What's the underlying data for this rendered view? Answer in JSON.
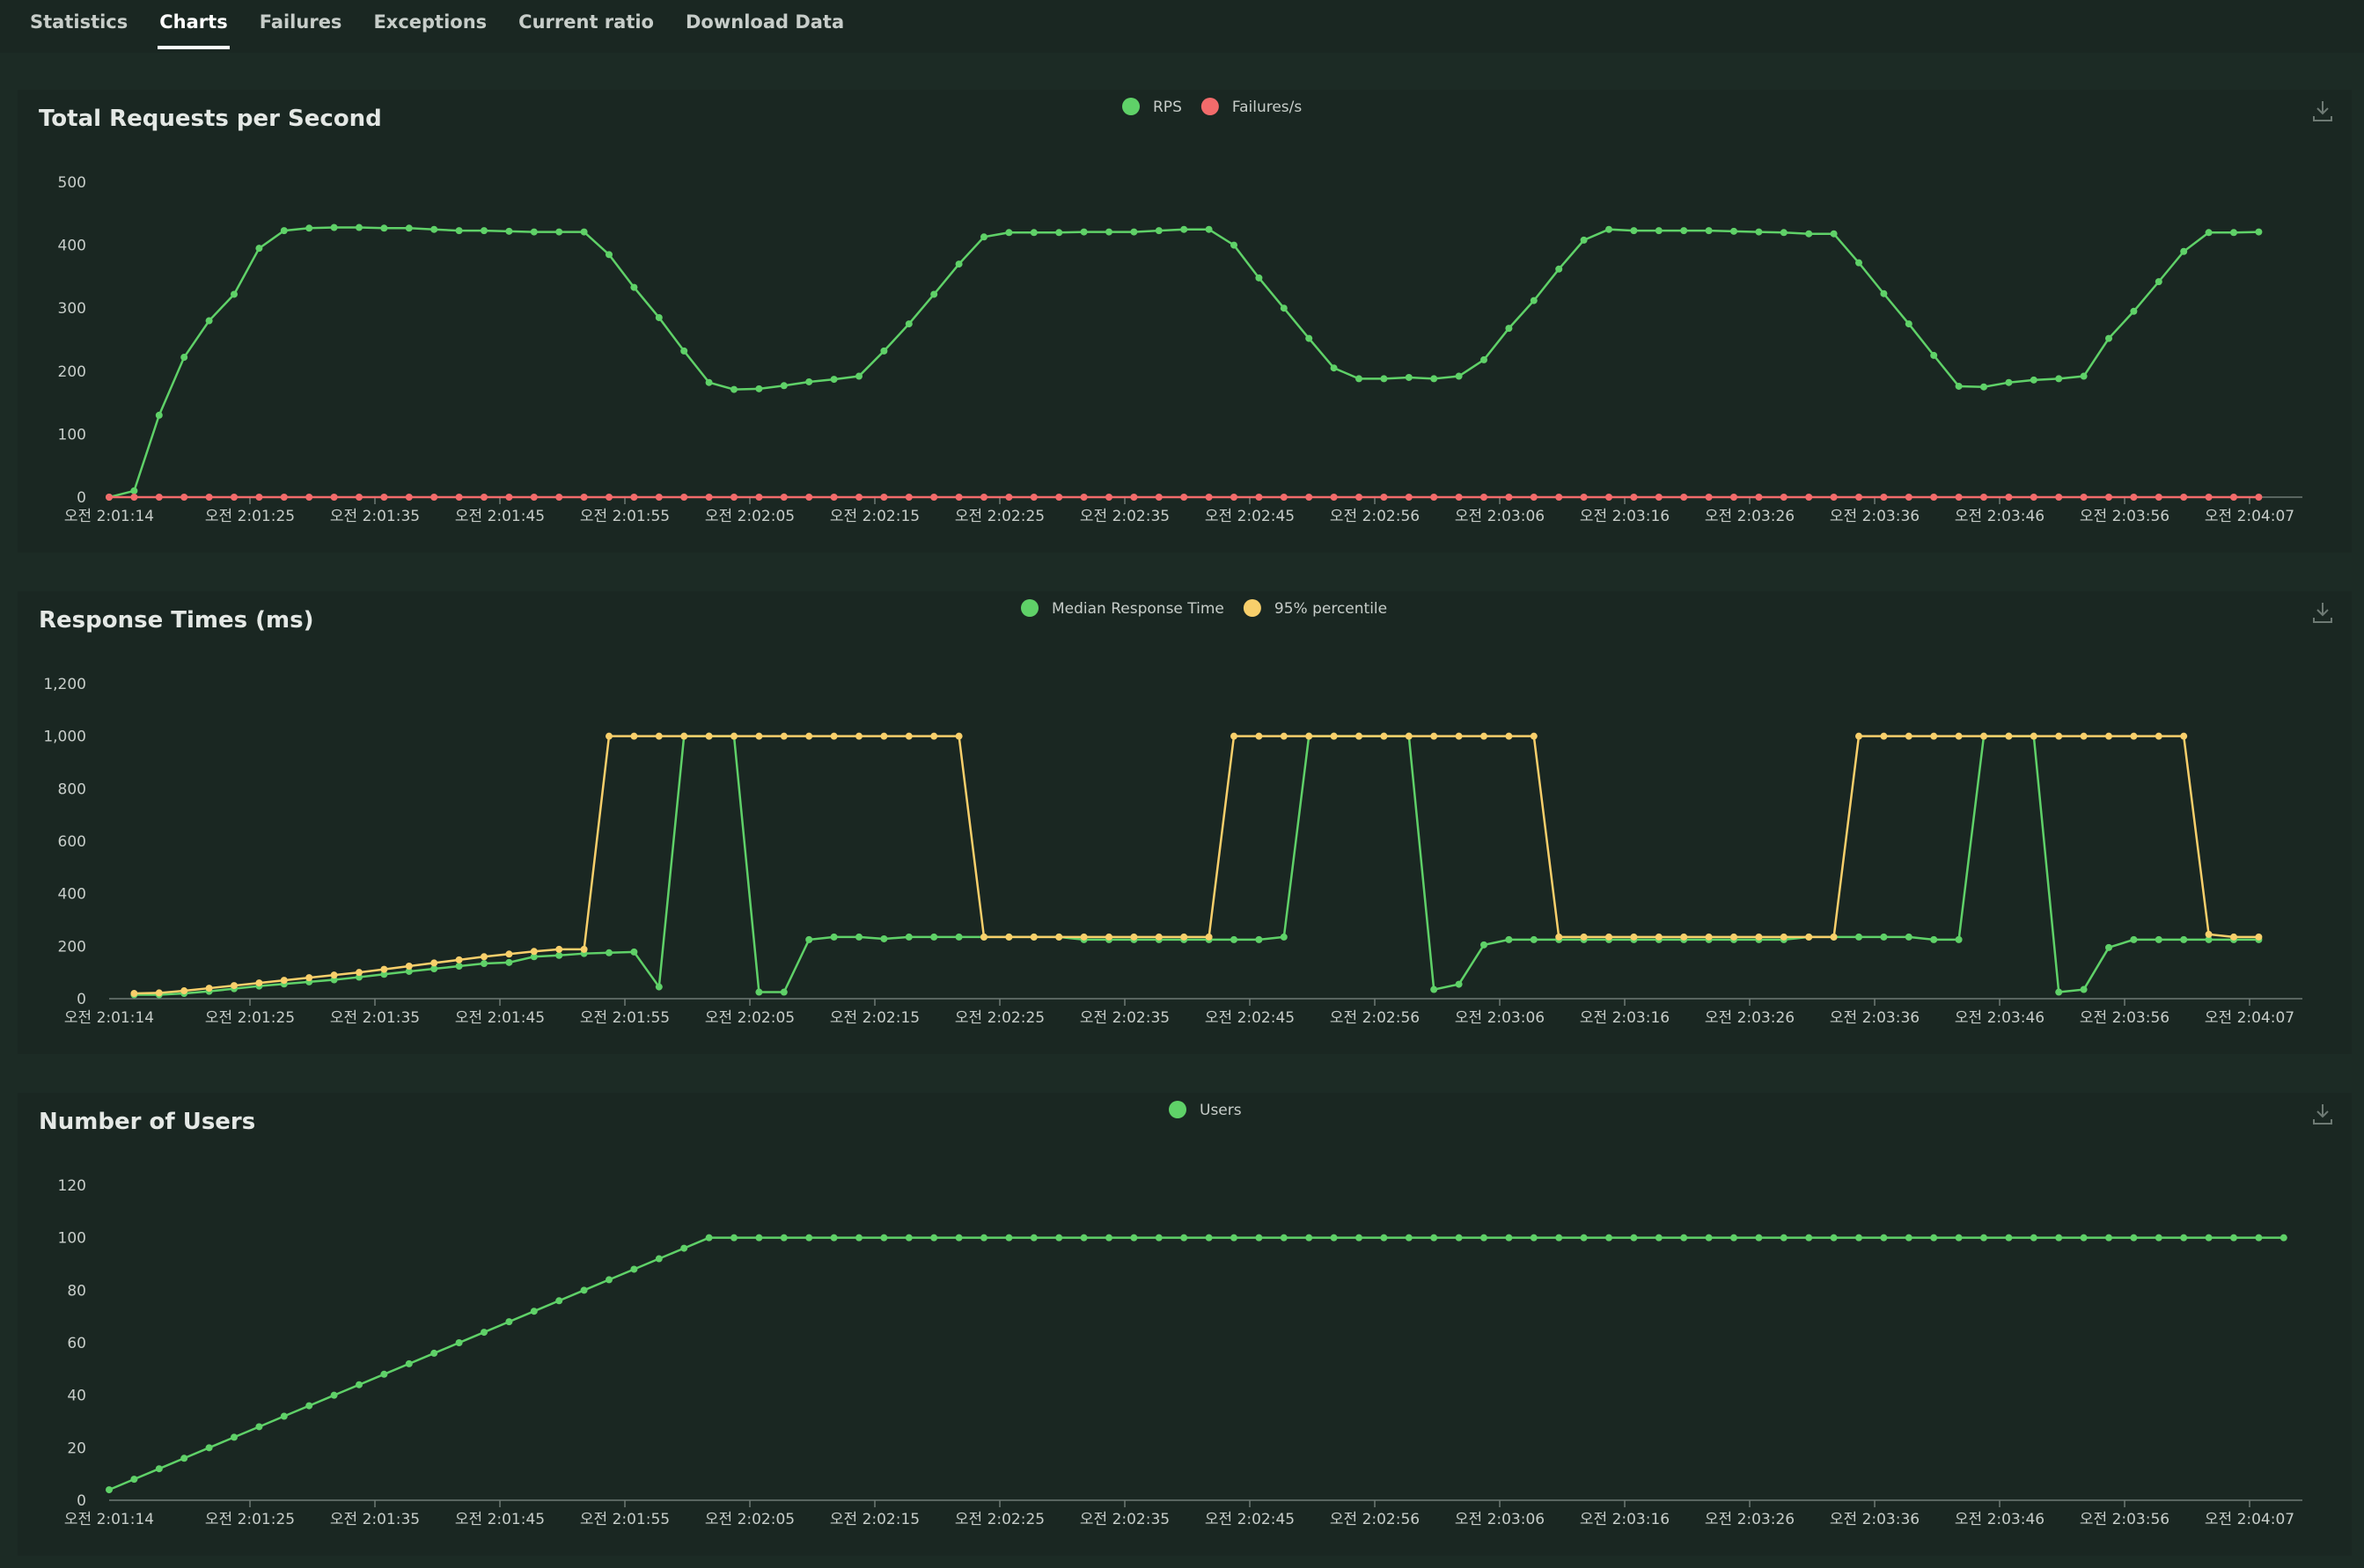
{
  "tabs": [
    {
      "label": "Statistics",
      "active": false
    },
    {
      "label": "Charts",
      "active": true
    },
    {
      "label": "Failures",
      "active": false
    },
    {
      "label": "Exceptions",
      "active": false
    },
    {
      "label": "Current ratio",
      "active": false
    },
    {
      "label": "Download Data",
      "active": false
    }
  ],
  "colors": {
    "page_bg": "#1c2b25",
    "panel_bg": "#1a2722",
    "green": "#5fd168",
    "red": "#f26b6b",
    "yellow": "#f8cf6b",
    "axis": "#6e7a74",
    "text": "#c7cdc9"
  },
  "x_tick_labels": [
    "오전 2:01:14",
    "오전 2:01:25",
    "오전 2:01:35",
    "오전 2:01:45",
    "오전 2:01:55",
    "오전 2:02:05",
    "오전 2:02:15",
    "오전 2:02:25",
    "오전 2:02:35",
    "오전 2:02:45",
    "오전 2:02:56",
    "오전 2:03:06",
    "오전 2:03:16",
    "오전 2:03:26",
    "오전 2:03:36",
    "오전 2:03:46",
    "오전 2:03:56",
    "오전 2:04:07"
  ],
  "chart_data": [
    {
      "type": "line",
      "title": "Total Requests per Second",
      "ylim": [
        0,
        500
      ],
      "yticks": [
        0,
        100,
        200,
        300,
        400,
        500
      ],
      "legend_position": "top-center",
      "grid": false,
      "series": [
        {
          "name": "RPS",
          "color": "#5fd168",
          "values": [
            0,
            10,
            130,
            222,
            280,
            322,
            395,
            423,
            427,
            428,
            428,
            427,
            427,
            425,
            423,
            423,
            422,
            421,
            421,
            421,
            385,
            333,
            285,
            232,
            182,
            171,
            172,
            177,
            183,
            187,
            192,
            232,
            275,
            322,
            370,
            413,
            420,
            420,
            420,
            421,
            421,
            421,
            423,
            425,
            425,
            400,
            348,
            300,
            252,
            205,
            188,
            188,
            190,
            188,
            192,
            218,
            268,
            312,
            362,
            408,
            425,
            423,
            423,
            423,
            423,
            422,
            421,
            420,
            418,
            418,
            372,
            323,
            275,
            225,
            176,
            175,
            182,
            186,
            188,
            192,
            252,
            295,
            342,
            390,
            420,
            420,
            421
          ]
        },
        {
          "name": "Failures/s",
          "color": "#f26b6b",
          "values": [
            0,
            0,
            0,
            0,
            0,
            0,
            0,
            0,
            0,
            0,
            0,
            0,
            0,
            0,
            0,
            0,
            0,
            0,
            0,
            0,
            0,
            0,
            0,
            0,
            0,
            0,
            0,
            0,
            0,
            0,
            0,
            0,
            0,
            0,
            0,
            0,
            0,
            0,
            0,
            0,
            0,
            0,
            0,
            0,
            0,
            0,
            0,
            0,
            0,
            0,
            0,
            0,
            0,
            0,
            0,
            0,
            0,
            0,
            0,
            0,
            0,
            0,
            0,
            0,
            0,
            0,
            0,
            0,
            0,
            0,
            0,
            0,
            0,
            0,
            0,
            0,
            0,
            0,
            0,
            0,
            0,
            0,
            0,
            0,
            0,
            0,
            0
          ]
        }
      ]
    },
    {
      "type": "line",
      "title": "Response Times (ms)",
      "ylim": [
        0,
        1200
      ],
      "yticks": [
        0,
        200,
        400,
        600,
        800,
        1000,
        1200
      ],
      "legend_position": "top-center",
      "grid": false,
      "series": [
        {
          "name": "Median Response Time",
          "color": "#5fd168",
          "start": 1,
          "values": [
            15,
            15,
            20,
            28,
            38,
            48,
            56,
            64,
            72,
            82,
            93,
            104,
            114,
            124,
            134,
            138,
            160,
            165,
            172,
            175,
            178,
            45,
            1000,
            1000,
            1000,
            25,
            25,
            225,
            235,
            235,
            228,
            235,
            235,
            235,
            235,
            235,
            235,
            235,
            225,
            225,
            225,
            225,
            225,
            225,
            225,
            225,
            235,
            1000,
            1000,
            1000,
            1000,
            1000,
            35,
            55,
            205,
            225,
            225,
            225,
            225,
            225,
            225,
            225,
            225,
            225,
            225,
            225,
            225,
            235,
            235,
            235,
            235,
            235,
            225,
            225,
            1000,
            1000,
            1000,
            25,
            35,
            195,
            225,
            225,
            225,
            225,
            225,
            225
          ]
        },
        {
          "name": "95% percentile",
          "color": "#f8cf6b",
          "start": 1,
          "values": [
            20,
            22,
            30,
            40,
            50,
            60,
            70,
            80,
            90,
            100,
            112,
            124,
            136,
            148,
            160,
            170,
            180,
            188,
            188,
            1000,
            1000,
            1000,
            1000,
            1000,
            1000,
            1000,
            1000,
            1000,
            1000,
            1000,
            1000,
            1000,
            1000,
            1000,
            235,
            235,
            235,
            235,
            235,
            235,
            235,
            235,
            235,
            235,
            1000,
            1000,
            1000,
            1000,
            1000,
            1000,
            1000,
            1000,
            1000,
            1000,
            1000,
            1000,
            1000,
            235,
            235,
            235,
            235,
            235,
            235,
            235,
            235,
            235,
            235,
            235,
            235,
            1000,
            1000,
            1000,
            1000,
            1000,
            1000,
            1000,
            1000,
            1000,
            1000,
            1000,
            1000,
            1000,
            1000,
            245,
            235,
            235
          ]
        }
      ]
    },
    {
      "type": "line",
      "title": "Number of Users",
      "ylim": [
        0,
        120
      ],
      "yticks": [
        0,
        20,
        40,
        60,
        80,
        100,
        120
      ],
      "legend_position": "top-center",
      "grid": false,
      "series": [
        {
          "name": "Users",
          "color": "#5fd168",
          "values": [
            4,
            8,
            12,
            16,
            20,
            24,
            28,
            32,
            36,
            40,
            44,
            48,
            52,
            56,
            60,
            64,
            68,
            72,
            76,
            80,
            84,
            88,
            92,
            96,
            100,
            100,
            100,
            100,
            100,
            100,
            100,
            100,
            100,
            100,
            100,
            100,
            100,
            100,
            100,
            100,
            100,
            100,
            100,
            100,
            100,
            100,
            100,
            100,
            100,
            100,
            100,
            100,
            100,
            100,
            100,
            100,
            100,
            100,
            100,
            100,
            100,
            100,
            100,
            100,
            100,
            100,
            100,
            100,
            100,
            100,
            100,
            100,
            100,
            100,
            100,
            100,
            100,
            100,
            100,
            100,
            100,
            100,
            100,
            100,
            100,
            100,
            100,
            100
          ]
        }
      ]
    }
  ]
}
